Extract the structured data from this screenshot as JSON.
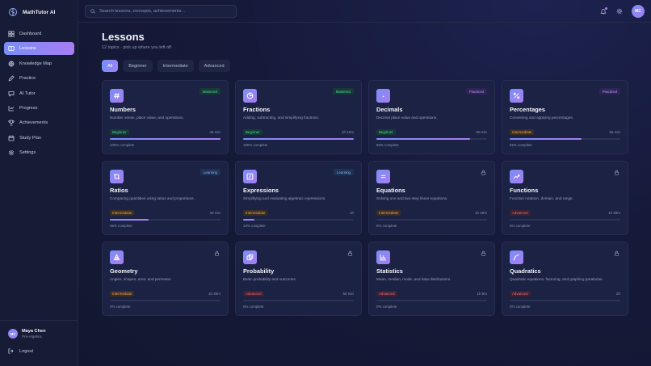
{
  "app": {
    "name": "MathTutor AI"
  },
  "sidebar": {
    "items": [
      {
        "label": "Dashboard",
        "icon": "dashboard-icon",
        "active": false
      },
      {
        "label": "Lessons",
        "icon": "book-icon",
        "active": true
      },
      {
        "label": "Knowledge Map",
        "icon": "globe-icon",
        "active": false
      },
      {
        "label": "Practice",
        "icon": "pencil-icon",
        "active": false
      },
      {
        "label": "AI Tutor",
        "icon": "chat-icon",
        "active": false
      },
      {
        "label": "Progress",
        "icon": "chart-icon",
        "active": false
      },
      {
        "label": "Achievements",
        "icon": "trophy-icon",
        "active": false
      },
      {
        "label": "Study Plan",
        "icon": "calendar-icon",
        "active": false
      },
      {
        "label": "Settings",
        "icon": "gear-icon",
        "active": false
      }
    ],
    "user": {
      "initials": "MC",
      "name": "Maya Chen",
      "course": "Pre-Algebra"
    },
    "logout_label": "Logout"
  },
  "topbar": {
    "search_placeholder": "Search lessons, concepts, achievements...",
    "avatar_initials": "MC"
  },
  "page": {
    "title": "Lessons",
    "subtitle": "12 topics · pick up where you left off"
  },
  "filters": [
    {
      "label": "All",
      "active": true
    },
    {
      "label": "Beginner",
      "active": false
    },
    {
      "label": "Intermediate",
      "active": false
    },
    {
      "label": "Advanced",
      "active": false
    }
  ],
  "lessons": [
    {
      "title": "Numbers",
      "desc": "Number sense, place value, and operations.",
      "level": "Beginner",
      "duration": "45 min",
      "progress": 100,
      "progress_label": "100% complete",
      "status": "Mastered",
      "locked": false,
      "icon": "hash-icon"
    },
    {
      "title": "Fractions",
      "desc": "Adding, subtracting, and simplifying fractions.",
      "level": "Beginner",
      "duration": "1h 10m",
      "progress": 100,
      "progress_label": "100% complete",
      "status": "Mastered",
      "locked": false,
      "icon": "pie-icon"
    },
    {
      "title": "Decimals",
      "desc": "Decimal place value and operations.",
      "level": "Beginner",
      "duration": "50 min",
      "progress": 85,
      "progress_label": "85% complete",
      "status": "Practiced",
      "locked": false,
      "icon": "dot-icon"
    },
    {
      "title": "Percentages",
      "desc": "Converting and applying percentages.",
      "level": "Intermediate",
      "duration": "55 min",
      "progress": 65,
      "progress_label": "65% complete",
      "status": "Practiced",
      "locked": false,
      "icon": "percent-icon"
    },
    {
      "title": "Ratios",
      "desc": "Comparing quantities using ratios and proportions.",
      "level": "Intermediate",
      "duration": "40 min",
      "progress": 35,
      "progress_label": "35% complete",
      "status": "Learning",
      "locked": false,
      "icon": "ratio-icon"
    },
    {
      "title": "Expressions",
      "desc": "Simplifying and evaluating algebraic expressions.",
      "level": "Intermediate",
      "duration": "1h",
      "progress": 10,
      "progress_label": "10% complete",
      "status": "Learning",
      "locked": false,
      "icon": "expression-icon"
    },
    {
      "title": "Equations",
      "desc": "Solving one and two-step linear equations.",
      "level": "Intermediate",
      "duration": "1h 20m",
      "progress": 0,
      "progress_label": "0% complete",
      "status": "",
      "locked": true,
      "icon": "equals-icon"
    },
    {
      "title": "Functions",
      "desc": "Function notation, domain, and range.",
      "level": "Advanced",
      "duration": "1h 30m",
      "progress": 0,
      "progress_label": "0% complete",
      "status": "",
      "locked": true,
      "icon": "trend-icon"
    },
    {
      "title": "Geometry",
      "desc": "Angles, shapes, area, and perimeter.",
      "level": "Intermediate",
      "duration": "1h 40m",
      "progress": 0,
      "progress_label": "0% complete",
      "status": "",
      "locked": true,
      "icon": "shapes-icon"
    },
    {
      "title": "Probability",
      "desc": "Basic probability and outcomes.",
      "level": "Advanced",
      "duration": "50 min",
      "progress": 0,
      "progress_label": "0% complete",
      "status": "",
      "locked": true,
      "icon": "dice-icon"
    },
    {
      "title": "Statistics",
      "desc": "Mean, median, mode, and data distributions.",
      "level": "Advanced",
      "duration": "1h 5m",
      "progress": 0,
      "progress_label": "0% complete",
      "status": "",
      "locked": true,
      "icon": "bar-chart-icon"
    },
    {
      "title": "Quadratics",
      "desc": "Quadratic equations, factoring, and graphing parabolas.",
      "level": "Advanced",
      "duration": "2h",
      "progress": 0,
      "progress_label": "0% complete",
      "status": "",
      "locked": true,
      "icon": "curve-icon"
    }
  ],
  "colors": {
    "accent_start": "#7a8ef7",
    "accent_end": "#a77df2",
    "beginner": "#4fd69c",
    "intermediate": "#f0a55b",
    "advanced": "#f06b7f"
  }
}
